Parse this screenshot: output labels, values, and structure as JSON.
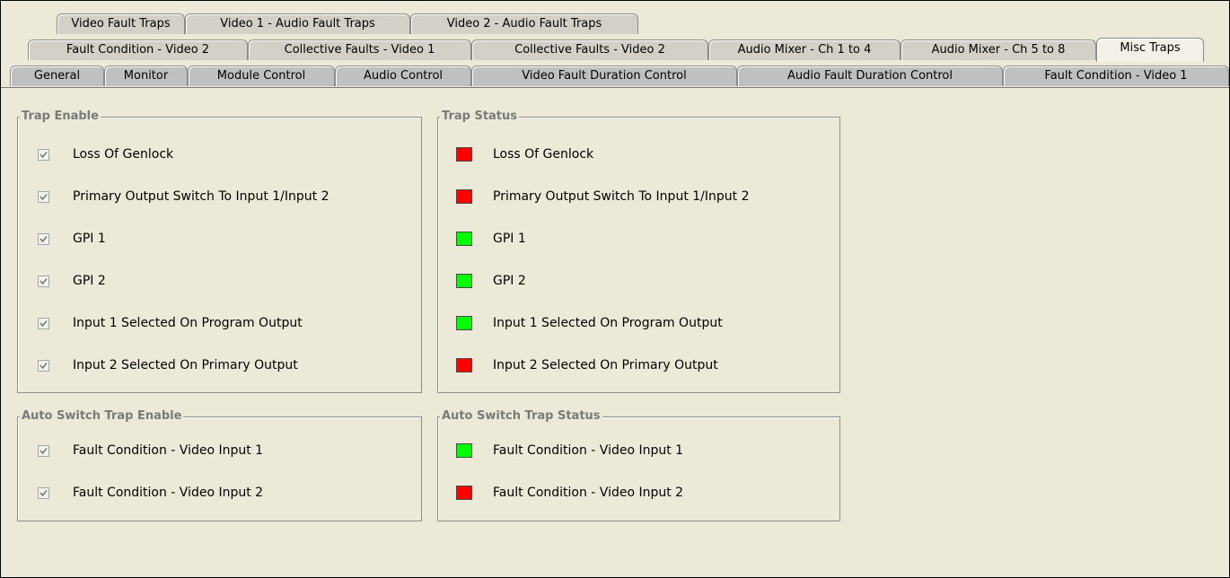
{
  "tabs": {
    "row1": [
      "Video Fault Traps",
      "Video 1 - Audio Fault Traps",
      "Video 2 - Audio Fault Traps"
    ],
    "row2": [
      "Fault Condition - Video 2",
      "Collective Faults - Video 1",
      "Collective Faults - Video 2",
      "Audio Mixer - Ch 1 to 4",
      "Audio Mixer - Ch 5 to 8",
      "Misc Traps"
    ],
    "row3": [
      "General",
      "Monitor",
      "Module Control",
      "Audio Control",
      "Video Fault Duration Control",
      "Audio Fault Duration Control",
      "Fault Condition - Video 1"
    ],
    "active": "Misc Traps"
  },
  "trap_enable": {
    "title": "Trap Enable",
    "items": [
      {
        "label": "Loss Of Genlock",
        "checked": true
      },
      {
        "label": "Primary Output Switch To Input 1/Input 2",
        "checked": true
      },
      {
        "label": "GPI 1",
        "checked": true
      },
      {
        "label": "GPI 2",
        "checked": true
      },
      {
        "label": "Input 1 Selected On Program Output",
        "checked": true
      },
      {
        "label": "Input 2 Selected On Primary Output",
        "checked": true
      }
    ]
  },
  "trap_status": {
    "title": "Trap Status",
    "items": [
      {
        "label": "Loss Of Genlock",
        "color": "#ff0000"
      },
      {
        "label": "Primary Output Switch To Input 1/Input 2",
        "color": "#ff0000"
      },
      {
        "label": "GPI 1",
        "color": "#00ff00"
      },
      {
        "label": "GPI 2",
        "color": "#00ff00"
      },
      {
        "label": "Input 1 Selected On Program Output",
        "color": "#00ff00"
      },
      {
        "label": "Input 2 Selected On Primary Output",
        "color": "#ff0000"
      }
    ]
  },
  "auto_switch_enable": {
    "title": "Auto Switch Trap Enable",
    "items": [
      {
        "label": "Fault Condition - Video Input 1",
        "checked": true
      },
      {
        "label": "Fault Condition - Video Input 2",
        "checked": true
      }
    ]
  },
  "auto_switch_status": {
    "title": "Auto Switch Trap Status",
    "items": [
      {
        "label": "Fault Condition - Video Input 1",
        "color": "#00ff00"
      },
      {
        "label": "Fault Condition - Video Input 2",
        "color": "#ff0000"
      }
    ]
  }
}
